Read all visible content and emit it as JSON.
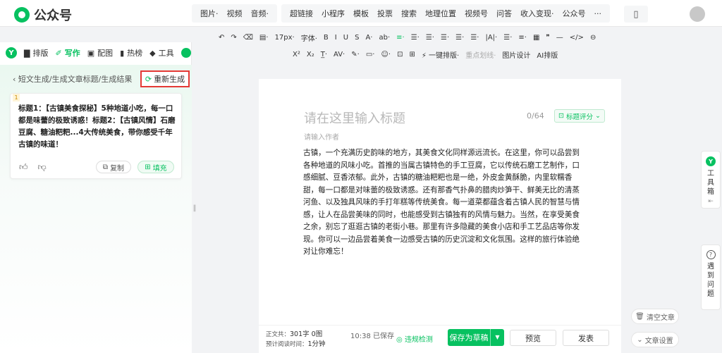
{
  "app": {
    "title": "公众号"
  },
  "insert_menu": {
    "group1": [
      "图片·",
      "视频",
      "音频·"
    ],
    "group2": [
      "超链接",
      "小程序",
      "模板",
      "投票",
      "搜索",
      "地理位置",
      "视频号",
      "问答",
      "收入变现·",
      "公众号",
      "···"
    ]
  },
  "format_toolbar": {
    "row1": [
      "↶",
      "↷",
      "⌫",
      "▤·",
      "17px·",
      "字体·",
      "B",
      "I",
      "U",
      "S",
      "A·",
      "ab·",
      "≡·",
      "☰·",
      "☰·",
      "☰·",
      "☰·",
      "☰·",
      "|A|·",
      "☰·",
      "≡·",
      "▦",
      "❞",
      "—",
      "</>",
      "⊖"
    ],
    "row2": [
      "X²",
      "X₂",
      "T̲·",
      "AV·",
      "✎·",
      "▭·",
      "☺·",
      "⊡",
      "⊞",
      "⚡ 一键排版·",
      "重点划线·",
      "图片设计",
      "AI排版"
    ]
  },
  "left_tabs": [
    {
      "label": "排版",
      "icon": "layout-icon"
    },
    {
      "label": "写作",
      "icon": "write-icon",
      "active": true
    },
    {
      "label": "配图",
      "icon": "image-icon"
    },
    {
      "label": "热榜",
      "icon": "bookmark-icon"
    },
    {
      "label": "工具",
      "icon": "cube-icon"
    }
  ],
  "generator": {
    "breadcrumb": "短文生成/生成文章标题/生成结果",
    "regenerate_label": "重新生成",
    "result_index": "1",
    "result_text": "标题1：【古镇美食探秘】5种地道小吃，每一口都是味蕾的极致诱惑！标题2：【古镇风情】石磨豆腐、糖油粑粑...4大传统美食，带你感受千年古镇的味道！",
    "copy_label": "复制",
    "fill_label": "填充"
  },
  "editor": {
    "title_placeholder": "请在这里输入标题",
    "title_count": "0/64",
    "title_score_label": "标题评分",
    "author_placeholder": "请输入作者",
    "body": "古镇，一个充满历史韵味的地方，其美食文化同样源远流长。在这里，你可以品尝到各种地道的风味小吃。首推的当属古镇特色的手工豆腐，它以传统石磨工艺制作，口感细腻、豆香浓郁。此外，古镇的糖油粑粑也是一绝，外皮金黄酥脆，内里软糯香甜，每一口都是对味蕾的极致诱惑。还有那香气扑鼻的腊肉炒笋干、鲜美无比的清蒸河鱼、以及独具风味的手打年糕等传统美食。每一道菜都蕴含着古镇人民的智慧与情感，让人在品尝美味的同时，也能感受到古镇独有的风情与魅力。当然，在享受美食之余，别忘了逛逛古镇的老街小巷。那里有许多隐藏的美食小店和手工艺品店等你发现。你可以一边品尝着美食一边感受古镇的历史沉淀和文化氛围。这样的旅行体验绝对让你难忘！"
  },
  "footer": {
    "word_count_label": "正文共：",
    "word_count": "301字 0图",
    "read_time_label": "预计阅读时间：",
    "read_time": "1分钟",
    "saved_status": "10:38  已保存",
    "check_label": "违规检测",
    "save_label": "保存为草稿",
    "preview_label": "预览",
    "publish_label": "发表"
  },
  "side": {
    "toolbox_label": "工具箱",
    "help_label": "遇到问题",
    "clear_label": "清空文章",
    "settings_label": "文章设置"
  }
}
